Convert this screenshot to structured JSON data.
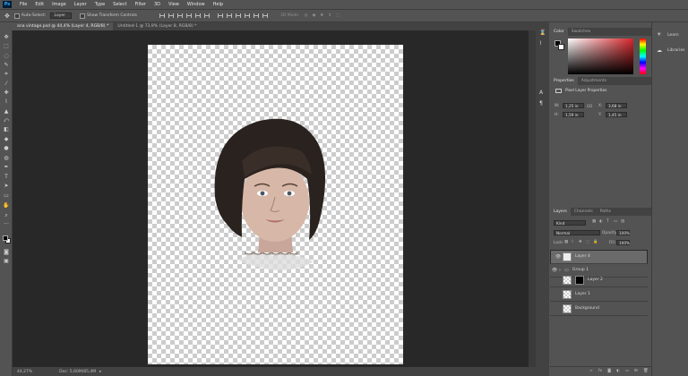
{
  "menu": [
    "File",
    "Edit",
    "Image",
    "Layer",
    "Type",
    "Select",
    "Filter",
    "3D",
    "View",
    "Window",
    "Help"
  ],
  "app_logo": "Ps",
  "options": {
    "auto_select": "Auto-Select:",
    "auto_select_target": "Layer",
    "transform": "Show Transform Controls",
    "mode3d": "3D Mode:"
  },
  "tabs": [
    {
      "label": "ana vintage.psd @ 44,4% (Layer 4, RGB/8) *"
    },
    {
      "label": "Untitled-1 @ 73,9% (Layer 8, RGB/8) *"
    }
  ],
  "status": {
    "zoom": "44,27%",
    "doc": "Doc: 5,60M/85,4M"
  },
  "color_panel": {
    "tabs": [
      "Color",
      "Swatches"
    ],
    "accent": "#d7262b"
  },
  "properties": {
    "tabs": [
      "Properties",
      "Adjustments"
    ],
    "title": "Pixel Layer Properties",
    "W": "1,25 in",
    "H": "1,59 in",
    "X": "3,68 in",
    "Y": "1,45 in",
    "go": "GO"
  },
  "layers_panel": {
    "tabs": [
      "Layers",
      "Channels",
      "Paths"
    ],
    "kind": "Kind",
    "blend": "Normal",
    "opacity_label": "Opacity:",
    "opacity": "100%",
    "lock_label": "Lock:",
    "fill_label": "Fill:",
    "fill": "100%",
    "layers": [
      {
        "name": "Layer 4"
      },
      {
        "name": "Group 1"
      },
      {
        "name": "Layer 2"
      },
      {
        "name": "Layer 1"
      },
      {
        "name": "Background"
      }
    ]
  },
  "side": {
    "learn": "Learn",
    "libraries": "Libraries"
  }
}
